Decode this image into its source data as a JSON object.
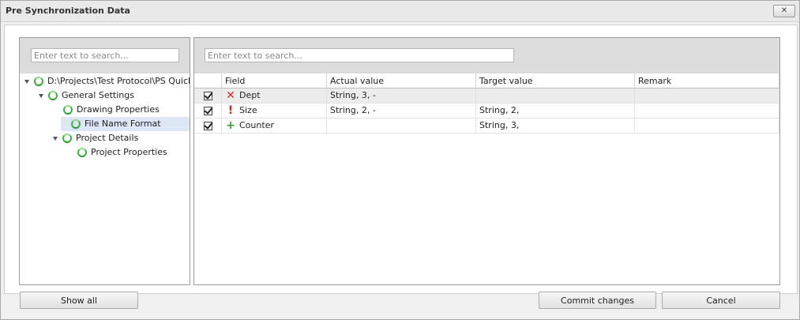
{
  "window": {
    "title": "Pre Synchronization Data",
    "close_symbol": "✕"
  },
  "left": {
    "search_placeholder": "Enter text to search...",
    "tree": [
      {
        "label": "D:\\Projects\\Test Protocol\\PS Quick - T",
        "level": 0,
        "expanded": true,
        "selected": false
      },
      {
        "label": "General Settings",
        "level": 1,
        "expanded": true,
        "selected": false
      },
      {
        "label": "Drawing Properties",
        "level": 2,
        "expanded": null,
        "selected": false
      },
      {
        "label": "File Name Format",
        "level": 2,
        "expanded": null,
        "selected": true
      },
      {
        "label": "Project Details",
        "level": 2,
        "expanded": true,
        "selected": false
      },
      {
        "label": "Project Properties",
        "level": 3,
        "expanded": null,
        "selected": false
      }
    ]
  },
  "right": {
    "search_placeholder": "Enter text to search...",
    "columns": [
      "Field",
      "Actual value",
      "Target value",
      "Remark"
    ],
    "rows": [
      {
        "checked": true,
        "icon": "delete-icon",
        "icon_glyph": "✕",
        "icon_color": "#d9261c",
        "field": "Dept",
        "actual": "String, 3, -",
        "target": "",
        "remark": "",
        "selected": true
      },
      {
        "checked": true,
        "icon": "warning-icon",
        "icon_glyph": "!",
        "icon_color": "#d9261c",
        "field": "Size",
        "actual": "String, 2, -",
        "target": "String, 2,",
        "remark": "",
        "selected": false
      },
      {
        "checked": true,
        "icon": "add-icon",
        "icon_glyph": "+",
        "icon_color": "#2e9e2e",
        "field": "Counter",
        "actual": "",
        "target": "String, 3,",
        "remark": "",
        "selected": false
      }
    ]
  },
  "buttons": {
    "show_all": "Show all",
    "commit": "Commit changes",
    "cancel": "Cancel"
  }
}
